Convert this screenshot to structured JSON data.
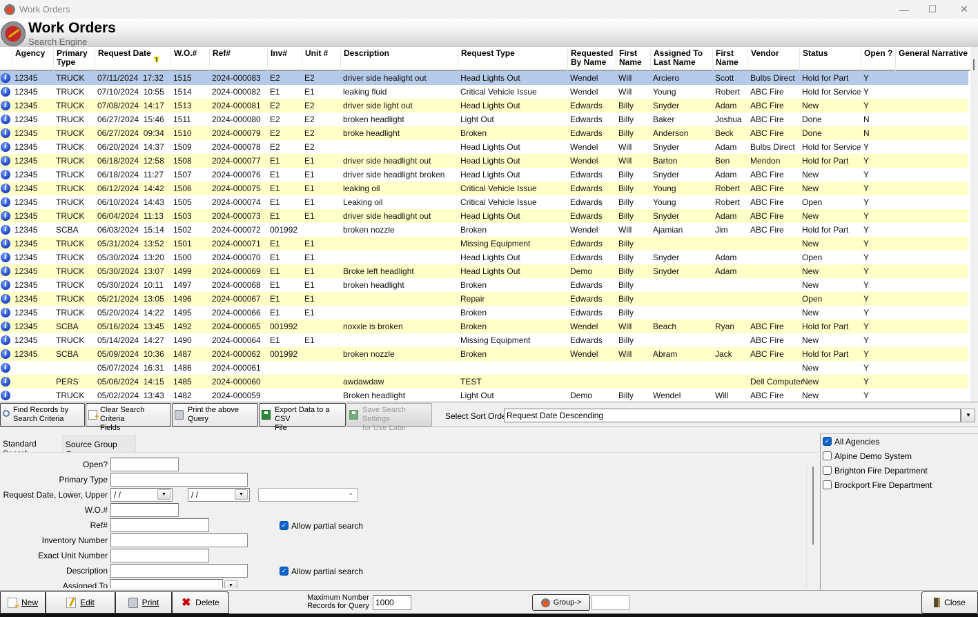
{
  "window": {
    "title": "Work Orders",
    "controls": {
      "minimize": "—",
      "maximize": "☐",
      "close": "✕"
    }
  },
  "header": {
    "title": "Work Orders",
    "subtitle": "Search Engine"
  },
  "grid": {
    "sort_indicator": "1",
    "columns": [
      {
        "key": "agency",
        "label": "Agency"
      },
      {
        "key": "primary_type",
        "label": "Primary\nType"
      },
      {
        "key": "request_date",
        "label": "Request Date"
      },
      {
        "key": "wo",
        "label": "W.O.#"
      },
      {
        "key": "ref",
        "label": "Ref#"
      },
      {
        "key": "inv",
        "label": "Inv#"
      },
      {
        "key": "unit",
        "label": "Unit #"
      },
      {
        "key": "description",
        "label": "Description"
      },
      {
        "key": "request_type",
        "label": "Request Type"
      },
      {
        "key": "requested_by",
        "label": "Requested\nBy Name"
      },
      {
        "key": "req_first",
        "label": "First\nName"
      },
      {
        "key": "assigned_last",
        "label": "Assigned To\nLast Name"
      },
      {
        "key": "assigned_first",
        "label": "First\nName"
      },
      {
        "key": "vendor",
        "label": "Vendor"
      },
      {
        "key": "status",
        "label": "Status"
      },
      {
        "key": "open",
        "label": "Open ?"
      },
      {
        "key": "narrative",
        "label": "General Narrative"
      }
    ],
    "rows": [
      [
        "12345",
        "TRUCK",
        "07/11/2024  17:32",
        "1515",
        "2024-000083",
        "E2",
        "E2",
        "driver side healight out",
        "Head Lights Out",
        "Wendel",
        "Will",
        "Arciero",
        "Scott",
        "Bulbs Direct",
        "Hold for Part",
        "Y",
        ""
      ],
      [
        "12345",
        "TRUCK",
        "07/10/2024  10:55",
        "1514",
        "2024-000082",
        "E1",
        "E1",
        "leaking fluid",
        "Critical Vehicle Issue",
        "Wendel",
        "Will",
        "Young",
        "Robert",
        "ABC Fire",
        "Hold for Service",
        "Y",
        ""
      ],
      [
        "12345",
        "TRUCK",
        "07/08/2024  14:17",
        "1513",
        "2024-000081",
        "E2",
        "E2",
        "driver side light out",
        "Head Lights Out",
        "Edwards",
        "Billy",
        "Snyder",
        "Adam",
        "ABC Fire",
        "New",
        "Y",
        ""
      ],
      [
        "12345",
        "TRUCK",
        "06/27/2024  15:46",
        "1511",
        "2024-000080",
        "E2",
        "E2",
        "broken headlight",
        "Light Out",
        "Edwards",
        "Billy",
        "Baker",
        "Joshua",
        "ABC Fire",
        "Done",
        "N",
        ""
      ],
      [
        "12345",
        "TRUCK",
        "06/27/2024  09:34",
        "1510",
        "2024-000079",
        "E2",
        "E2",
        "broke headlight",
        "Broken",
        "Edwards",
        "Billy",
        "Anderson",
        "Beck",
        "ABC Fire",
        "Done",
        "N",
        ""
      ],
      [
        "12345",
        "TRUCK",
        "06/20/2024  14:37",
        "1509",
        "2024-000078",
        "E2",
        "E2",
        "",
        "Head Lights Out",
        "Wendel",
        "Will",
        "Snyder",
        "Adam",
        "Bulbs Direct",
        "Hold for Service",
        "Y",
        ""
      ],
      [
        "12345",
        "TRUCK",
        "06/18/2024  12:58",
        "1508",
        "2024-000077",
        "E1",
        "E1",
        "driver side headlight out",
        "Head Lights Out",
        "Wendel",
        "Will",
        "Barton",
        "Ben",
        "Mendon",
        "Hold for Part",
        "Y",
        ""
      ],
      [
        "12345",
        "TRUCK",
        "06/18/2024  11:27",
        "1507",
        "2024-000076",
        "E1",
        "E1",
        "driver side headlight broken",
        "Head Lights Out",
        "Edwards",
        "Billy",
        "Snyder",
        "Adam",
        "ABC Fire",
        "New",
        "Y",
        ""
      ],
      [
        "12345",
        "TRUCK",
        "06/12/2024  14:42",
        "1506",
        "2024-000075",
        "E1",
        "E1",
        "leaking oil",
        "Critical Vehicle Issue",
        "Edwards",
        "Billy",
        "Young",
        "Robert",
        "ABC Fire",
        "New",
        "Y",
        ""
      ],
      [
        "12345",
        "TRUCK",
        "06/10/2024  14:43",
        "1505",
        "2024-000074",
        "E1",
        "E1",
        "Leaking oil",
        "Critical Vehicle Issue",
        "Edwards",
        "Billy",
        "Young",
        "Robert",
        "ABC Fire",
        "Open",
        "Y",
        ""
      ],
      [
        "12345",
        "TRUCK",
        "06/04/2024  11:13",
        "1503",
        "2024-000073",
        "E1",
        "E1",
        "driver side headlight out",
        "Head Lights Out",
        "Edwards",
        "Billy",
        "Snyder",
        "Adam",
        "ABC Fire",
        "New",
        "Y",
        ""
      ],
      [
        "12345",
        "SCBA",
        "06/03/2024  15:14",
        "1502",
        "2024-000072",
        "001992",
        "",
        "broken nozzle",
        "Broken",
        "Wendel",
        "Will",
        "Ajamian",
        "Jim",
        "ABC Fire",
        "Hold for Part",
        "Y",
        ""
      ],
      [
        "12345",
        "TRUCK",
        "05/31/2024  13:52",
        "1501",
        "2024-000071",
        "E1",
        "E1",
        "",
        "Missing Equipment",
        "Edwards",
        "Billy",
        "",
        "",
        "",
        "New",
        "Y",
        ""
      ],
      [
        "12345",
        "TRUCK",
        "05/30/2024  13:20",
        "1500",
        "2024-000070",
        "E1",
        "E1",
        "",
        "Head Lights Out",
        "Edwards",
        "Billy",
        "Snyder",
        "Adam",
        "",
        "Open",
        "Y",
        ""
      ],
      [
        "12345",
        "TRUCK",
        "05/30/2024  13:07",
        "1499",
        "2024-000069",
        "E1",
        "E1",
        "Broke left headlight",
        "Head Lights Out",
        "Demo",
        "Billy",
        "Snyder",
        "Adam",
        "",
        "New",
        "Y",
        ""
      ],
      [
        "12345",
        "TRUCK",
        "05/30/2024  10:11",
        "1497",
        "2024-000068",
        "E1",
        "E1",
        "broken headlight",
        "Broken",
        "Edwards",
        "Billy",
        "",
        "",
        "",
        "New",
        "Y",
        ""
      ],
      [
        "12345",
        "TRUCK",
        "05/21/2024  13:05",
        "1496",
        "2024-000067",
        "E1",
        "E1",
        "",
        "Repair",
        "Edwards",
        "Billy",
        "",
        "",
        "",
        "Open",
        "Y",
        ""
      ],
      [
        "12345",
        "TRUCK",
        "05/20/2024  14:22",
        "1495",
        "2024-000066",
        "E1",
        "E1",
        "",
        "Broken",
        "Edwards",
        "Billy",
        "",
        "",
        "",
        "New",
        "Y",
        ""
      ],
      [
        "12345",
        "SCBA",
        "05/16/2024  13:45",
        "1492",
        "2024-000065",
        "001992",
        "",
        "noxxle is broken",
        "Broken",
        "Wendel",
        "Will",
        "Beach",
        "Ryan",
        "ABC Fire",
        "Hold for Part",
        "Y",
        ""
      ],
      [
        "12345",
        "TRUCK",
        "05/14/2024  14:27",
        "1490",
        "2024-000064",
        "E1",
        "E1",
        "",
        "Missing Equipment",
        "Edwards",
        "Billy",
        "",
        "",
        "ABC Fire",
        "New",
        "Y",
        ""
      ],
      [
        "12345",
        "SCBA",
        "05/09/2024  10:36",
        "1487",
        "2024-000062",
        "001992",
        "",
        "broken nozzle",
        "Broken",
        "Wendel",
        "Will",
        "Abram",
        "Jack",
        "ABC Fire",
        "Hold for Part",
        "Y",
        ""
      ],
      [
        "",
        "",
        "05/07/2024  16:31",
        "1486",
        "2024-000061",
        "",
        "",
        "",
        "",
        "",
        "",
        "",
        "",
        "",
        "New",
        "Y",
        ""
      ],
      [
        "",
        "PERS",
        "05/06/2024  14:15",
        "1485",
        "2024-000060",
        "",
        "",
        "awdawdaw",
        "TEST",
        "",
        "",
        "",
        "",
        "Dell Computer",
        "New",
        "Y",
        ""
      ],
      [
        "",
        "TRUCK",
        "05/02/2024  13:43",
        "1482",
        "2024-000059",
        "",
        "",
        "Broken headlight",
        "Light Out",
        "Demo",
        "Billy",
        "Wendel",
        "Will",
        "ABC Fire",
        "New",
        "Y",
        ""
      ]
    ]
  },
  "toolbar": {
    "find": {
      "line1": "Find Records by",
      "line2": "Search Criteria"
    },
    "clear": {
      "line1": "Clear Search Criteria",
      "line2": "Fields"
    },
    "print_query": {
      "line1": "Print the above",
      "line2": "Query"
    },
    "export": {
      "line1": "Export Data to a CSV",
      "line2": "File"
    },
    "save_settings": {
      "line1": "Save Search Settings",
      "line2": "for Use Later"
    },
    "sort_label": "Select Sort Order",
    "sort_value": "Request Date Descending"
  },
  "tabs": [
    {
      "label": "Standard Search",
      "active": true
    },
    {
      "label": "Source Group Query",
      "active": false
    }
  ],
  "search_form": {
    "open_label": "Open?",
    "open_value": "",
    "primary_type_label": "Primary Type",
    "primary_type_value": "",
    "request_date_label": "Request Date, Lower, Upper",
    "date_lower": " /  /",
    "date_upper": " /  /",
    "date_range_option": "",
    "wo_label": "W.O.#",
    "wo_value": "",
    "ref_label": "Ref#",
    "ref_value": "",
    "ref_partial_label": "Allow partial search",
    "ref_partial_checked": true,
    "inventory_label": "Inventory Number",
    "inventory_value": "",
    "unit_label": "Exact Unit Number",
    "unit_value": "",
    "description_label": "Description",
    "description_value": "",
    "desc_partial_label": "Allow partial search",
    "desc_partial_checked": true,
    "assigned_label": "Assigned To",
    "assigned_value": ""
  },
  "agencies": [
    {
      "label": "All Agencies",
      "checked": true
    },
    {
      "label": "Alpine Demo System",
      "checked": false
    },
    {
      "label": "Brighton Fire Department",
      "checked": false
    },
    {
      "label": "Brockport Fire Department",
      "checked": false
    }
  ],
  "bottom": {
    "new_label": "New",
    "edit_label": "Edit",
    "print_label": "Print",
    "delete_label": "Delete",
    "max_label_1": "Maximum Number",
    "max_label_2": "Records for Query",
    "max_value": "1000",
    "group_label": "Group->",
    "group_value": "",
    "close_label": "Close"
  },
  "colors": {
    "row_alt": "#ffffc8",
    "row_selected": "#b5c9e8",
    "checkbox_checked": "#0e64c8"
  }
}
